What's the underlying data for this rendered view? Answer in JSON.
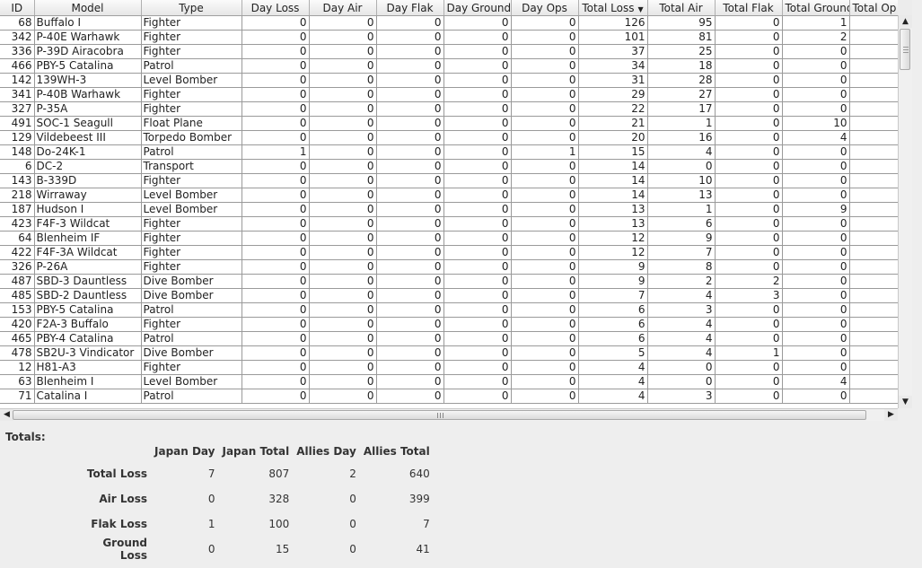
{
  "table": {
    "columns": [
      {
        "label": "ID",
        "align": "num"
      },
      {
        "label": "Model",
        "align": "txt"
      },
      {
        "label": "Type",
        "align": "txt"
      },
      {
        "label": "Day Loss",
        "align": "num"
      },
      {
        "label": "Day Air",
        "align": "num"
      },
      {
        "label": "Day Flak",
        "align": "num"
      },
      {
        "label": "Day Ground",
        "align": "num"
      },
      {
        "label": "Day Ops",
        "align": "num"
      },
      {
        "label": "Total Loss",
        "align": "num",
        "sorted": "desc"
      },
      {
        "label": "Total Air",
        "align": "num"
      },
      {
        "label": "Total Flak",
        "align": "num"
      },
      {
        "label": "Total Ground",
        "align": "num"
      },
      {
        "label": "Total Op",
        "align": "num"
      }
    ],
    "rows": [
      [
        "68",
        "Buffalo I",
        "Fighter",
        "0",
        "0",
        "0",
        "0",
        "0",
        "126",
        "95",
        "0",
        "1",
        ""
      ],
      [
        "342",
        "P-40E Warhawk",
        "Fighter",
        "0",
        "0",
        "0",
        "0",
        "0",
        "101",
        "81",
        "0",
        "2",
        ""
      ],
      [
        "336",
        "P-39D Airacobra",
        "Fighter",
        "0",
        "0",
        "0",
        "0",
        "0",
        "37",
        "25",
        "0",
        "0",
        ""
      ],
      [
        "466",
        "PBY-5 Catalina",
        "Patrol",
        "0",
        "0",
        "0",
        "0",
        "0",
        "34",
        "18",
        "0",
        "0",
        ""
      ],
      [
        "142",
        "139WH-3",
        "Level Bomber",
        "0",
        "0",
        "0",
        "0",
        "0",
        "31",
        "28",
        "0",
        "0",
        ""
      ],
      [
        "341",
        "P-40B Warhawk",
        "Fighter",
        "0",
        "0",
        "0",
        "0",
        "0",
        "29",
        "27",
        "0",
        "0",
        ""
      ],
      [
        "327",
        "P-35A",
        "Fighter",
        "0",
        "0",
        "0",
        "0",
        "0",
        "22",
        "17",
        "0",
        "0",
        ""
      ],
      [
        "491",
        "SOC-1 Seagull",
        "Float Plane",
        "0",
        "0",
        "0",
        "0",
        "0",
        "21",
        "1",
        "0",
        "10",
        ""
      ],
      [
        "129",
        "Vildebeest III",
        "Torpedo Bomber",
        "0",
        "0",
        "0",
        "0",
        "0",
        "20",
        "16",
        "0",
        "4",
        ""
      ],
      [
        "148",
        "Do-24K-1",
        "Patrol",
        "1",
        "0",
        "0",
        "0",
        "1",
        "15",
        "4",
        "0",
        "0",
        ""
      ],
      [
        "6",
        "DC-2",
        "Transport",
        "0",
        "0",
        "0",
        "0",
        "0",
        "14",
        "0",
        "0",
        "0",
        ""
      ],
      [
        "143",
        "B-339D",
        "Fighter",
        "0",
        "0",
        "0",
        "0",
        "0",
        "14",
        "10",
        "0",
        "0",
        ""
      ],
      [
        "218",
        "Wirraway",
        "Level Bomber",
        "0",
        "0",
        "0",
        "0",
        "0",
        "14",
        "13",
        "0",
        "0",
        ""
      ],
      [
        "187",
        "Hudson I",
        "Level Bomber",
        "0",
        "0",
        "0",
        "0",
        "0",
        "13",
        "1",
        "0",
        "9",
        ""
      ],
      [
        "423",
        "F4F-3 Wildcat",
        "Fighter",
        "0",
        "0",
        "0",
        "0",
        "0",
        "13",
        "6",
        "0",
        "0",
        ""
      ],
      [
        "64",
        "Blenheim IF",
        "Fighter",
        "0",
        "0",
        "0",
        "0",
        "0",
        "12",
        "9",
        "0",
        "0",
        ""
      ],
      [
        "422",
        "F4F-3A Wildcat",
        "Fighter",
        "0",
        "0",
        "0",
        "0",
        "0",
        "12",
        "7",
        "0",
        "0",
        ""
      ],
      [
        "326",
        "P-26A",
        "Fighter",
        "0",
        "0",
        "0",
        "0",
        "0",
        "9",
        "8",
        "0",
        "0",
        ""
      ],
      [
        "487",
        "SBD-3 Dauntless",
        "Dive Bomber",
        "0",
        "0",
        "0",
        "0",
        "0",
        "9",
        "2",
        "2",
        "0",
        ""
      ],
      [
        "485",
        "SBD-2 Dauntless",
        "Dive Bomber",
        "0",
        "0",
        "0",
        "0",
        "0",
        "7",
        "4",
        "3",
        "0",
        ""
      ],
      [
        "153",
        "PBY-5 Catalina",
        "Patrol",
        "0",
        "0",
        "0",
        "0",
        "0",
        "6",
        "3",
        "0",
        "0",
        ""
      ],
      [
        "420",
        "F2A-3 Buffalo",
        "Fighter",
        "0",
        "0",
        "0",
        "0",
        "0",
        "6",
        "4",
        "0",
        "0",
        ""
      ],
      [
        "465",
        "PBY-4 Catalina",
        "Patrol",
        "0",
        "0",
        "0",
        "0",
        "0",
        "6",
        "4",
        "0",
        "0",
        ""
      ],
      [
        "478",
        "SB2U-3 Vindicator",
        "Dive Bomber",
        "0",
        "0",
        "0",
        "0",
        "0",
        "5",
        "4",
        "1",
        "0",
        ""
      ],
      [
        "12",
        "H81-A3",
        "Fighter",
        "0",
        "0",
        "0",
        "0",
        "0",
        "4",
        "0",
        "0",
        "0",
        ""
      ],
      [
        "63",
        "Blenheim I",
        "Level Bomber",
        "0",
        "0",
        "0",
        "0",
        "0",
        "4",
        "0",
        "0",
        "4",
        ""
      ],
      [
        "71",
        "Catalina I",
        "Patrol",
        "0",
        "0",
        "0",
        "0",
        "0",
        "4",
        "3",
        "0",
        "0",
        ""
      ]
    ]
  },
  "totals": {
    "heading": "Totals:",
    "headers": [
      "Japan Day",
      "Japan Total",
      "Allies Day",
      "Allies Total"
    ],
    "rows": [
      {
        "label": "Total Loss",
        "values": [
          "7",
          "807",
          "2",
          "640"
        ]
      },
      {
        "label": "Air Loss",
        "values": [
          "0",
          "328",
          "0",
          "399"
        ]
      },
      {
        "label": "Flak Loss",
        "values": [
          "1",
          "100",
          "0",
          "7"
        ]
      },
      {
        "label": "Ground Loss",
        "values": [
          "0",
          "15",
          "0",
          "41"
        ]
      }
    ]
  },
  "icons": {
    "sort": "triangle-down-icon",
    "scroll_up": "arrow-up-icon",
    "scroll_down": "arrow-down-icon",
    "scroll_left": "arrow-left-icon",
    "scroll_right": "arrow-right-icon"
  }
}
